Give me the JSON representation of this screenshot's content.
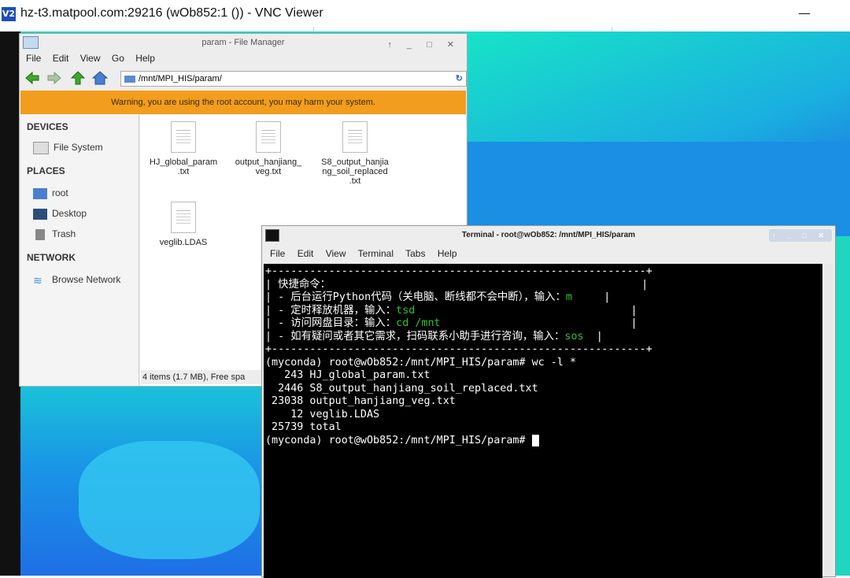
{
  "vnc": {
    "logo": "V2",
    "title": "hz-t3.matpool.com:29216 (wOb852:1 ()) - VNC Viewer",
    "minimize": "—"
  },
  "file_manager": {
    "title": "param - File Manager",
    "window_buttons": "↑ _ □ ✕",
    "menu": [
      "File",
      "Edit",
      "View",
      "Go",
      "Help"
    ],
    "location": "/mnt/MPI_HIS/param/",
    "warning": "Warning, you are using the root account, you may harm your system.",
    "sidebar": {
      "devices_header": "DEVICES",
      "file_system": "File System",
      "places_header": "PLACES",
      "root": "root",
      "desktop": "Desktop",
      "trash": "Trash",
      "network_header": "NETWORK",
      "browse_network": "Browse Network"
    },
    "files": [
      {
        "name": "HJ_global_param\n.txt"
      },
      {
        "name": "output_hanjiang_\nveg.txt"
      },
      {
        "name": "S8_output_hanjia\nng_soil_replaced\n.txt"
      },
      {
        "name": "veglib.LDAS"
      }
    ],
    "status": "4 items (1.7 MB), Free spa"
  },
  "terminal": {
    "title": "Terminal - root@wOb852: /mnt/MPI_HIS/param",
    "window_buttons": "↑ _ □ ✕",
    "menu": [
      "File",
      "Edit",
      "View",
      "Terminal",
      "Tabs",
      "Help"
    ],
    "banner_border": "+-----------------------------------------------------------+",
    "banner_lines": [
      {
        "text": "| 快捷命令：",
        "cmd": "",
        "tail": "                                                 |"
      },
      {
        "text": "| - 后台运行Python代码（关电脑、断线都不会中断），输入：",
        "cmd": "m",
        "tail": "     |"
      },
      {
        "text": "| - 定时释放机器，输入：",
        "cmd": "tsd",
        "tail": "                                  |"
      },
      {
        "text": "| - 访问网盘目录：输入：",
        "cmd": "cd /mnt",
        "tail": "                              |"
      },
      {
        "text": "| - 如有疑问或者其它需求，扫码联系小助手进行咨询，输入：",
        "cmd": "sos",
        "tail": "  |"
      }
    ],
    "prompt": "(myconda) root@wOb852:/mnt/MPI_HIS/param#",
    "command": " wc -l *",
    "output": [
      "   243 HJ_global_param.txt",
      "  2446 S8_output_hanjiang_soil_replaced.txt",
      " 23038 output_hanjiang_veg.txt",
      "    12 veglib.LDAS",
      " 25739 total"
    ],
    "prompt2": "(myconda) root@wOb852:/mnt/MPI_HIS/param# "
  }
}
